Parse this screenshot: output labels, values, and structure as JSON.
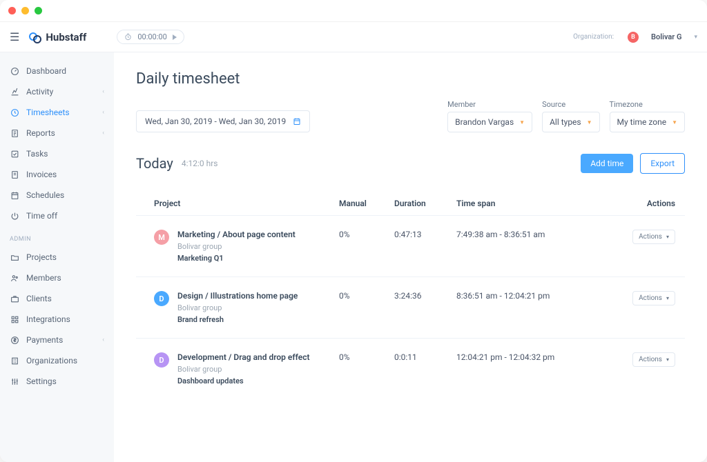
{
  "brand": "Hubstaff",
  "timer": "00:00:00",
  "org": {
    "label": "Organization:",
    "initial": "B",
    "name": "Bolivar G"
  },
  "sidebar": {
    "main": [
      {
        "label": "Dashboard"
      },
      {
        "label": "Activity",
        "chevron": true
      },
      {
        "label": "Timesheets",
        "chevron": true,
        "active": true
      },
      {
        "label": "Reports",
        "chevron": true
      },
      {
        "label": "Tasks"
      },
      {
        "label": "Invoices"
      },
      {
        "label": "Schedules"
      },
      {
        "label": "Time off"
      }
    ],
    "admin_label": "ADMIN",
    "admin": [
      {
        "label": "Projects"
      },
      {
        "label": "Members"
      },
      {
        "label": "Clients"
      },
      {
        "label": "Integrations"
      },
      {
        "label": "Payments",
        "chevron": true
      },
      {
        "label": "Organizations"
      },
      {
        "label": "Settings"
      }
    ]
  },
  "page": {
    "title": "Daily timesheet",
    "date_range": "Wed, Jan 30, 2019 - Wed, Jan 30, 2019",
    "filters": {
      "member": {
        "label": "Member",
        "value": "Brandon Vargas"
      },
      "source": {
        "label": "Source",
        "value": "All types"
      },
      "timezone": {
        "label": "Timezone",
        "value": "My time zone"
      }
    },
    "today_label": "Today",
    "today_hrs": "4:12:0 hrs",
    "add_time": "Add time",
    "export": "Export",
    "columns": {
      "project": "Project",
      "manual": "Manual",
      "duration": "Duration",
      "span": "Time span",
      "actions": "Actions"
    },
    "actions_label": "Actions",
    "rows": [
      {
        "badge": "M",
        "color": "#f59fa6",
        "name": "Marketing / About page content",
        "group": "Bolivar group",
        "task": "Marketing Q1",
        "manual": "0%",
        "duration": "0:47:13",
        "span": "7:49:38 am - 8:36:51 am"
      },
      {
        "badge": "D",
        "color": "#4aa9ff",
        "name": "Design / Illustrations home page",
        "group": "Bolivar group",
        "task": "Brand refresh",
        "manual": "0%",
        "duration": "3:24:36",
        "span": "8:36:51 am - 12:04:21 pm"
      },
      {
        "badge": "D",
        "color": "#b794f4",
        "name": "Development / Drag and drop effect",
        "group": "Bolivar group",
        "task": "Dashboard updates",
        "manual": "0%",
        "duration": "0:0:11",
        "span": "12:04:21 pm - 12:04:32 pm"
      }
    ]
  }
}
